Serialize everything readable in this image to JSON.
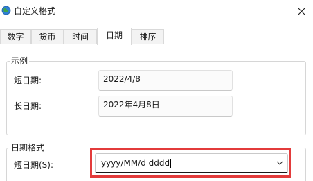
{
  "window": {
    "title": "自定义格式"
  },
  "tabs": [
    {
      "label": "数字"
    },
    {
      "label": "货币"
    },
    {
      "label": "时间"
    },
    {
      "label": "日期"
    },
    {
      "label": "排序"
    }
  ],
  "active_tab": "日期",
  "example": {
    "group_label": "示例",
    "short_date_label": "短日期:",
    "short_date_value": "2022/4/8",
    "long_date_label": "长日期:",
    "long_date_value": "2022年4月8日"
  },
  "date_format": {
    "group_label": "日期格式",
    "short_date_label": "短日期(S):",
    "short_date_value": "yyyy/MM/d dddd"
  },
  "colors": {
    "highlight": "#e33b3b",
    "app_icon_blue": "#2f7fd4",
    "app_icon_green": "#3ea54a"
  },
  "icons": {
    "app": "globe-clock-icon",
    "close": "close-icon",
    "dropdown": "chevron-down-icon"
  }
}
